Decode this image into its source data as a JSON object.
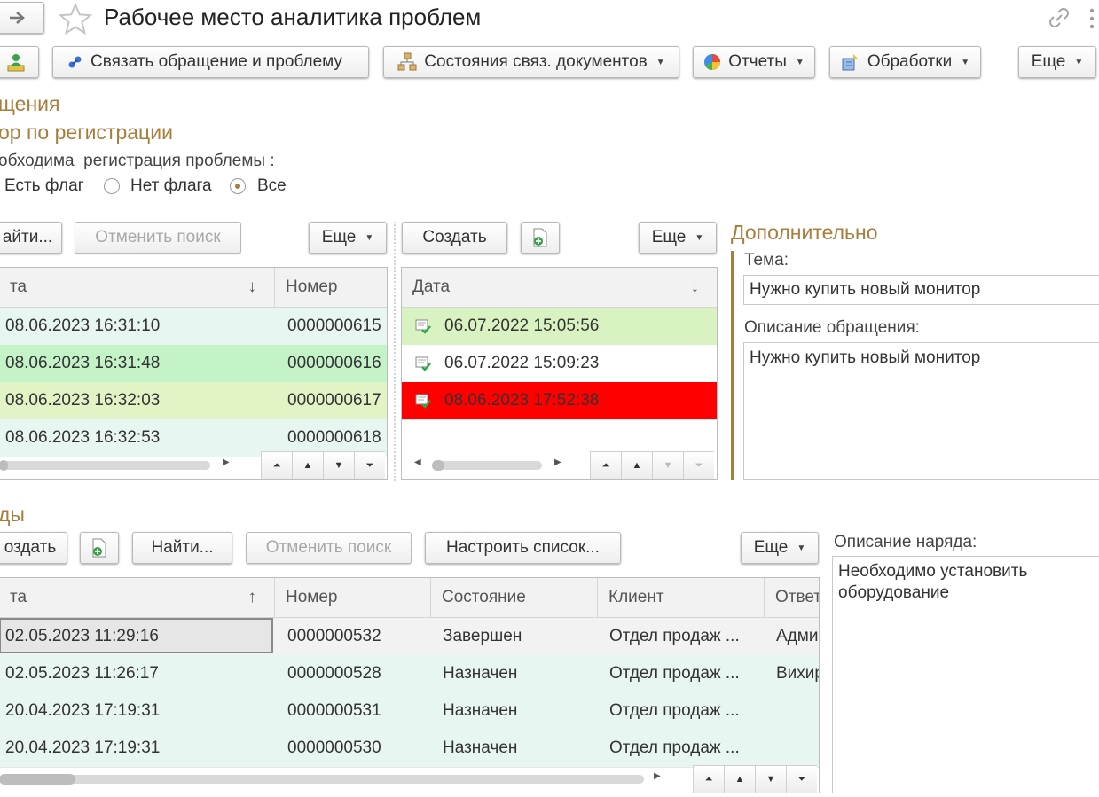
{
  "window": {
    "title": "Рабочее место аналитика проблем",
    "nav_forward_icon": "arrow-right-icon",
    "favorite_icon": "star-icon",
    "link_icon": "link-icon",
    "menu_icon": "more-vertical-icon"
  },
  "toolbar": {
    "link_label": "Связать обращение и проблему",
    "states_label": "Состояния связ. документов",
    "reports_label": "Отчеты",
    "processing_label": "Обработки",
    "more_label": "Еще"
  },
  "filter": {
    "section_title": "щения",
    "subtitle": "ор по регистрации",
    "question": "обходима  регистрация проблемы :",
    "options": [
      {
        "label": "Есть флаг",
        "selected": false
      },
      {
        "label": "Нет флага",
        "selected": false
      },
      {
        "label": "Все",
        "selected": true
      }
    ]
  },
  "requests": {
    "find_label": "айти...",
    "cancel_search_label": "Отменить поиск",
    "more_label": "Еще",
    "columns": [
      "та",
      "Номер"
    ],
    "sort_indicator": "↓",
    "rows": [
      {
        "date": "08.06.2023 16:31:10",
        "number": "0000000615",
        "color": "#e8f6f2"
      },
      {
        "date": "08.06.2023 16:31:48",
        "number": "0000000616",
        "color": "#c4f3c8"
      },
      {
        "date": "08.06.2023 16:32:03",
        "number": "0000000617",
        "color": "#e2f4c6"
      },
      {
        "date": "08.06.2023 16:32:53",
        "number": "0000000618",
        "color": "#e8f6f2"
      }
    ]
  },
  "linked": {
    "create_label": "Создать",
    "more_label": "Еще",
    "columns": [
      "Дата"
    ],
    "sort_indicator": "↓",
    "rows": [
      {
        "date": "06.07.2022 15:05:56",
        "color": "#d9f2c2"
      },
      {
        "date": "06.07.2022 15:09:23",
        "color": "#ffffff"
      },
      {
        "date": "08.06.2023 17:52:38",
        "color": "#ff0000"
      }
    ]
  },
  "additional": {
    "title": "Дополнительно",
    "topic_label": "Тема:",
    "topic_value": "Нужно купить новый монитор",
    "description_label": "Описание обращения:",
    "description_value": "Нужно купить новый монитор"
  },
  "orders": {
    "section_title": "ды",
    "create_label": "оздать",
    "find_label": "Найти...",
    "cancel_search_label": "Отменить поиск",
    "configure_label": "Настроить список...",
    "more_label": "Еще",
    "columns": [
      "та",
      "Номер",
      "Состояние",
      "Клиент",
      "Ответ"
    ],
    "sort_indicator": "↑",
    "rows": [
      {
        "date": "02.05.2023 11:29:16",
        "number": "0000000532",
        "state": "Завершен",
        "client": "Отдел продаж ...",
        "resp": "Адми"
      },
      {
        "date": "02.05.2023 11:26:17",
        "number": "0000000528",
        "state": "Назначен",
        "client": "Отдел продаж ...",
        "resp": "Вихир"
      },
      {
        "date": "20.04.2023 17:19:31",
        "number": "0000000531",
        "state": "Назначен",
        "client": "Отдел продаж ...",
        "resp": ""
      },
      {
        "date": "20.04.2023 17:19:31",
        "number": "0000000530",
        "state": "Назначен",
        "client": "Отдел продаж ...",
        "resp": ""
      }
    ],
    "description_label": "Описание наряда:",
    "description_value": "Необходимо установить оборудование"
  }
}
